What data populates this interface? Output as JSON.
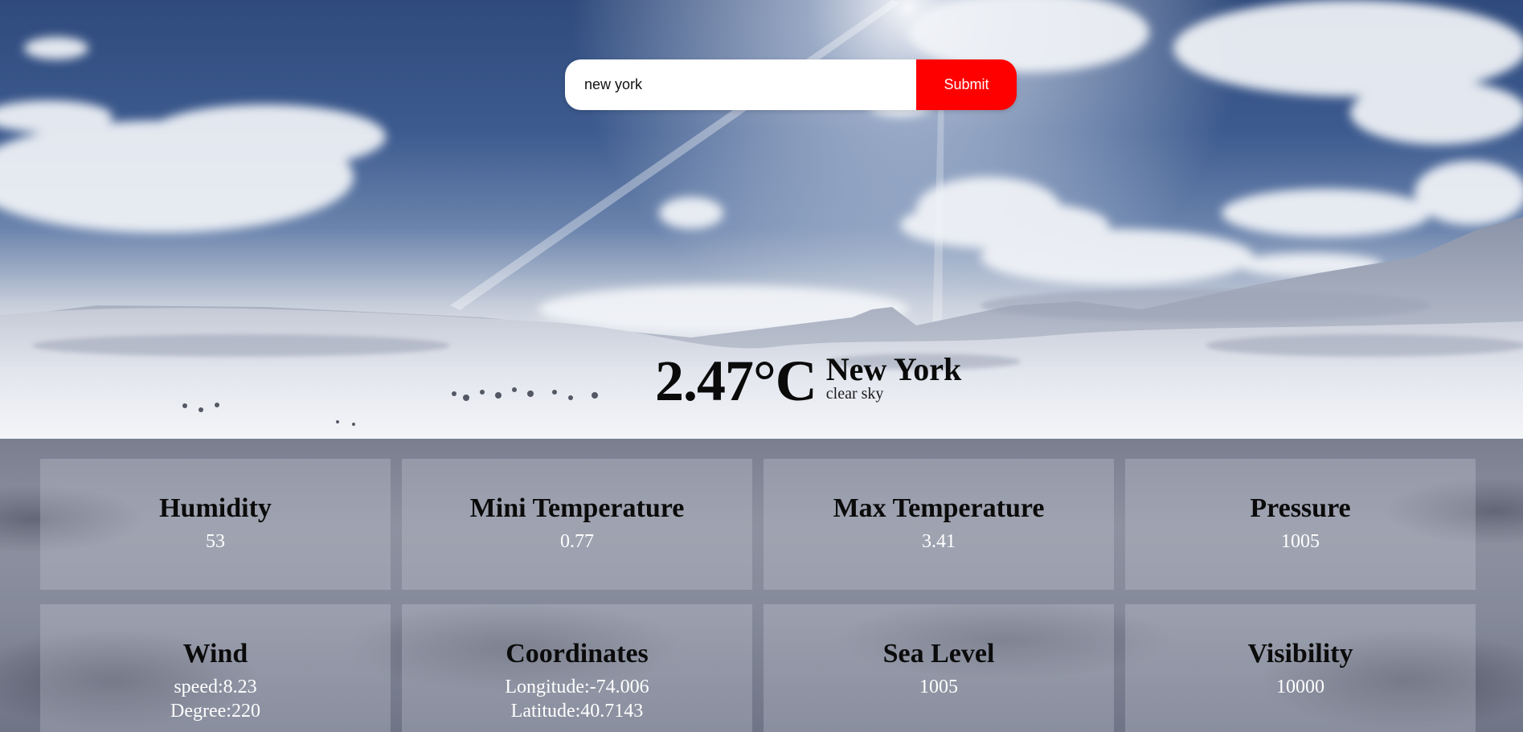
{
  "search": {
    "value": "new york",
    "submit_label": "Submit"
  },
  "current": {
    "temperature": "2.47°C",
    "city": "New York",
    "description": "clear sky"
  },
  "cards": {
    "humidity": {
      "title": "Humidity",
      "value": "53"
    },
    "min_temp": {
      "title": "Mini Temperature",
      "value": "0.77"
    },
    "max_temp": {
      "title": "Max Temperature",
      "value": "3.41"
    },
    "pressure": {
      "title": "Pressure",
      "value": "1005"
    },
    "wind": {
      "title": "Wind",
      "speed": "speed:8.23",
      "degree": "Degree:220"
    },
    "coordinates": {
      "title": "Coordinates",
      "longitude": "Longitude:-74.006",
      "latitude": "Latitude:40.7143"
    },
    "sea_level": {
      "title": "Sea Level",
      "value": "1005"
    },
    "visibility": {
      "title": "Visibility",
      "value": "10000"
    }
  },
  "colors": {
    "submit": "#ff0000",
    "input_bg": "#ffffff",
    "card_title": "#0b0b0b",
    "card_value": "#ffffff"
  }
}
